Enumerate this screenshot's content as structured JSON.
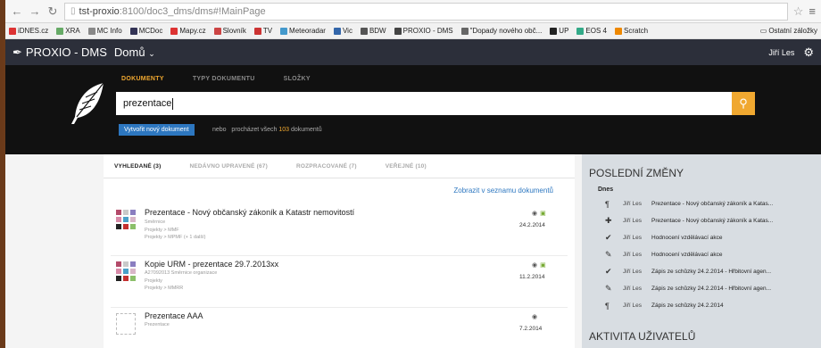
{
  "browser": {
    "url_prefix": "tst-proxio",
    "url_rest": ":8100/doc3_dms/dms#!MainPage",
    "bookmarks": [
      "iDNES.cz",
      "XRA",
      "MC Info",
      "MCDoc",
      "Mapy.cz",
      "Slovník",
      "TV",
      "Meteoradar",
      "Vic",
      "BDW",
      "PROXIO - DMS",
      "\"Dopady nového obč...",
      "UP",
      "EOS 4",
      "Scratch"
    ],
    "bookmarks_right": "Ostatní záložky"
  },
  "header": {
    "brand": "PROXIO - DMS",
    "home_label": "Domů",
    "user": "Jiří Les"
  },
  "search": {
    "tabs": [
      "DOKUMENTY",
      "TYPY DOKUMENTU",
      "SLOŽKY"
    ],
    "query": "prezentace",
    "new_doc_label": "Vytvořit nový dokument",
    "browse_prefix": "nebo",
    "browse_text": "procházet všech",
    "browse_count": "103",
    "browse_suffix": "dokumentů"
  },
  "results": {
    "tabs": [
      "VYHLEDANÉ (3)",
      "NEDÁVNO UPRAVENÉ (67)",
      "ROZPRACOVANÉ (7)",
      "VEŘEJNÉ (10)"
    ],
    "show_in_list": "Zobrazit v seznamu dokumentů",
    "docs": [
      {
        "title": "Prezentace - Nový občanský zákoník a Katastr nemovitostí",
        "line1": "Směrnice",
        "line2": "Projekty > MMF",
        "line3": "Projekty > MPMF (+ 1 další)",
        "date": "24.2.2014"
      },
      {
        "title": "Kopie URM - prezentace 29.7.2013xx",
        "line1": "A27092013   Směrnice organizace",
        "line2": "Projekty",
        "line3": "Projekty > MMRR",
        "date": "11.2.2014"
      },
      {
        "title": "Prezentace AAA",
        "line1": "Prezentace",
        "line2": "",
        "line3": "",
        "date": "7.2.2014"
      }
    ]
  },
  "sidebar": {
    "title": "POSLEDNÍ ZMĚNY",
    "day": "Dnes",
    "activities": [
      {
        "icon": "¶",
        "user": "Jiří Les",
        "text": "Prezentace - Nový občanský zákoník a Katas..."
      },
      {
        "icon": "✚",
        "user": "Jiří Les",
        "text": "Prezentace - Nový občanský zákoník a Katas..."
      },
      {
        "icon": "✔",
        "user": "Jiří Les",
        "text": "Hodnocení vzdělávací akce"
      },
      {
        "icon": "✎",
        "user": "Jiří Les",
        "text": "Hodnocení vzdělávací akce"
      },
      {
        "icon": "✔",
        "user": "Jiří Les",
        "text": "Zápis ze schůzky 24.2.2014 - Hřbitovní agen..."
      },
      {
        "icon": "✎",
        "user": "Jiří Les",
        "text": "Zápis ze schůzky 24.2.2014 - Hřbitovní agen..."
      },
      {
        "icon": "¶",
        "user": "Jiří Les",
        "text": "Zápis ze schůzky 24.2.2014"
      }
    ],
    "title2": "AKTIVITA UŽIVATELŮ"
  }
}
